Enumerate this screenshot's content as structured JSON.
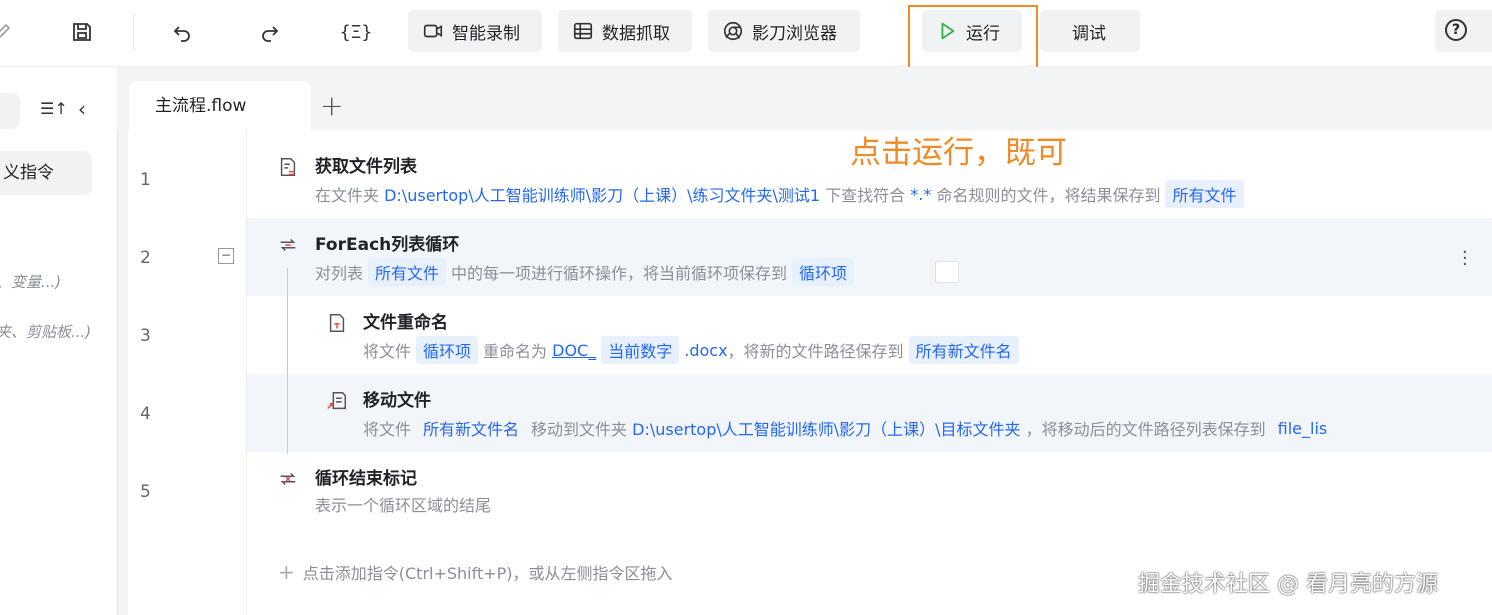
{
  "toolbar": {
    "icons": [
      "edit-icon",
      "save-icon",
      "undo-icon",
      "redo-icon",
      "variable-braces-icon"
    ],
    "variable_label": "{Ξ}",
    "record_label": "智能录制",
    "extract_label": "数据抓取",
    "browser_label": "影刀浏览器",
    "run_label": "运行",
    "debug_label": "调试",
    "help_label": "?"
  },
  "left_panel": {
    "custom_label": "义指令",
    "hint1": "、变量...)",
    "hint2": "夹、剪贴板...)"
  },
  "editor": {
    "tab_label": "主流程.flow",
    "tab_add": "+",
    "line_numbers": [
      "1",
      "2",
      "3",
      "4",
      "5"
    ],
    "collapse_symbol": "−",
    "commands": [
      {
        "title": "获取文件列表",
        "desc_prefix": "在文件夹",
        "path": "D:\\usertop\\人工智能训练师\\影刀（上课）\\练习文件夹\\测试1",
        "mid": "下查找符合",
        "pattern": "*.*",
        "mid2": "命名规则的文件，将结果保存到",
        "var": "所有文件"
      },
      {
        "title": "ForEach列表循环",
        "desc_prefix": "对列表",
        "list_var": "所有文件",
        "mid": "中的每一项进行循环操作，将当前循环项保存到",
        "item_var": "循环项"
      },
      {
        "title": "文件重命名",
        "desc_prefix": "将文件",
        "file_var": "循环项",
        "mid": "重命名为",
        "name_prefix": "DOC_",
        "name_var": "当前数字",
        "name_suffix": ".docx",
        "mid2": "，将新的文件路径保存到",
        "out_var": "所有新文件名"
      },
      {
        "title": "移动文件",
        "desc_prefix": "将文件",
        "file_var": "所有新文件名",
        "mid": "移动到文件夹",
        "path": "D:\\usertop\\人工智能训练师\\影刀（上课）\\目标文件夹",
        "mid2": "，将移动后的文件路径列表保存到",
        "out_var": "file_lis"
      },
      {
        "title": "循环结束标记",
        "desc": "表示一个循环区域的结尾"
      }
    ],
    "add_hint": "点击添加指令(Ctrl+Shift+P)，或从左侧指令区拖入"
  },
  "annotation": "点击运行，既可",
  "watermark": "掘金技术社区 @ 看月亮的方源",
  "colors": {
    "accent_orange": "#f08a24",
    "variable_blue": "#2468f2",
    "run_green": "#2fb344",
    "error_red": "#e5484d"
  }
}
